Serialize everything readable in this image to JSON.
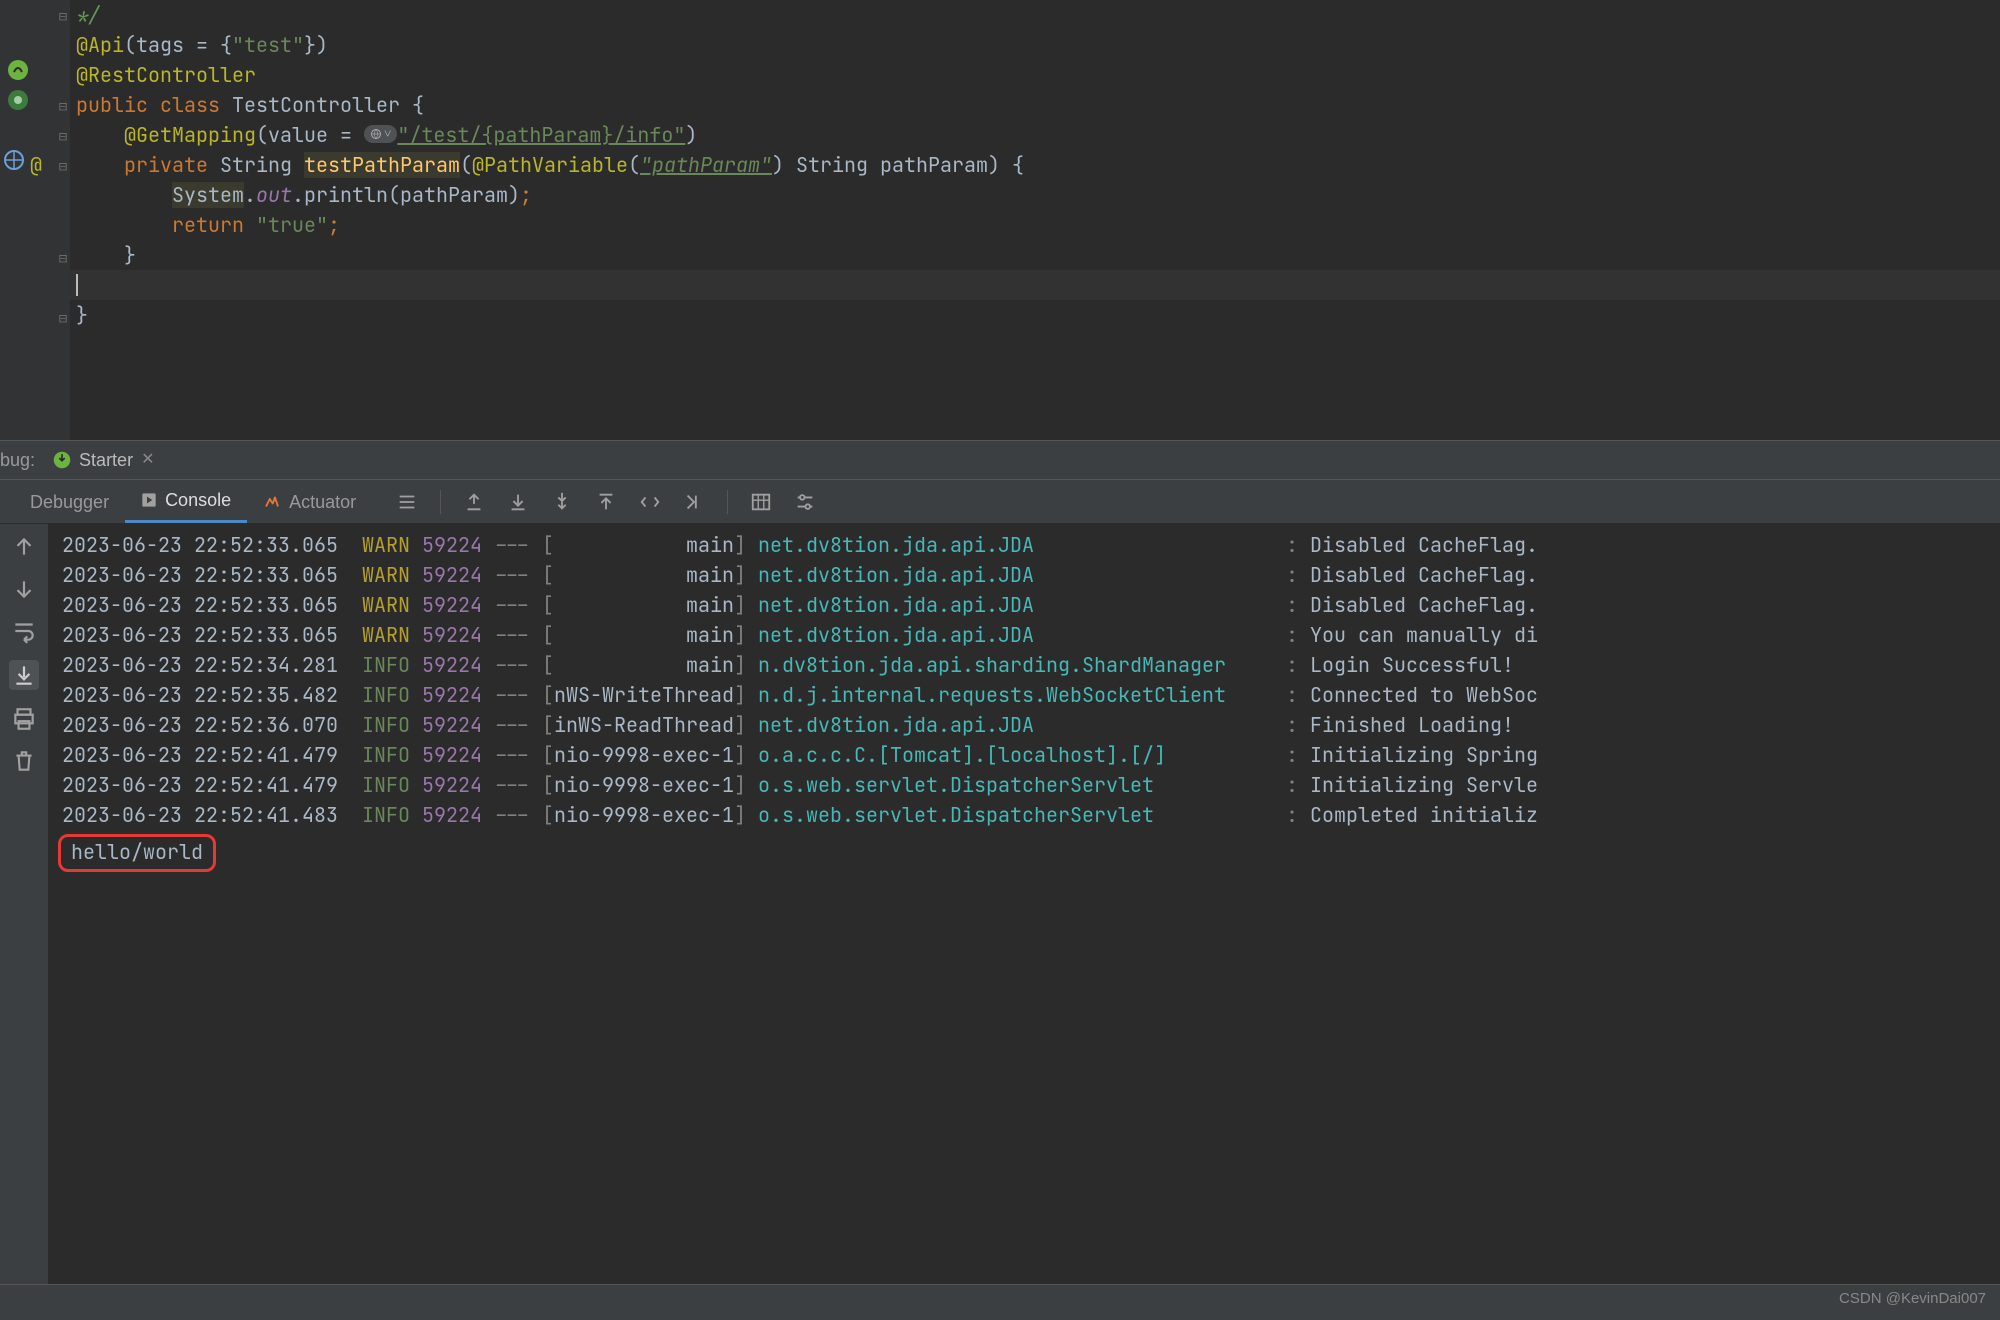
{
  "code": {
    "comment_close": "*/",
    "api_anno": "@Api",
    "api_args_open": "(tags = {",
    "api_tag": "\"test\"",
    "api_args_close": "})",
    "restctrl": "@RestController",
    "kw_public": "public",
    "kw_class": "class",
    "class_name": "TestController",
    "brace_open": "{",
    "getmap": "@GetMapping",
    "getmap_arg_open": "(value = ",
    "url": "\"/test/{pathParam}/info\"",
    "getmap_arg_close": ")",
    "kw_private": "private",
    "ret_type": "String",
    "method_name": "testPathParam",
    "pathvar": "@PathVariable",
    "pathvar_name": "\"pathParam\"",
    "param_type": "String",
    "param_name": "pathParam",
    "system": "System",
    "out": "out",
    "println": "println",
    "println_arg": "pathParam",
    "kw_return": "return",
    "ret_value": "\"true\"",
    "brace_close": "}"
  },
  "runcfg": {
    "label": "bug:",
    "tab": "Starter"
  },
  "tool_tabs": {
    "debugger": "Debugger",
    "console": "Console",
    "actuator": "Actuator"
  },
  "log_cols": {
    "ts": [
      "2023-06-23 22:52:33.065",
      "2023-06-23 22:52:33.065",
      "2023-06-23 22:52:33.065",
      "2023-06-23 22:52:33.065",
      "2023-06-23 22:52:34.281",
      "2023-06-23 22:52:35.482",
      "2023-06-23 22:52:36.070",
      "2023-06-23 22:52:41.479",
      "2023-06-23 22:52:41.479",
      "2023-06-23 22:52:41.483"
    ],
    "lvl": [
      "WARN",
      "WARN",
      "WARN",
      "WARN",
      "INFO",
      "INFO",
      "INFO",
      "INFO",
      "INFO",
      "INFO"
    ],
    "pid": "59224",
    "thr": [
      "           main",
      "           main",
      "           main",
      "           main",
      "           main",
      "nWS-WriteThread",
      "inWS-ReadThread",
      "nio-9998-exec-1",
      "nio-9998-exec-1",
      "nio-9998-exec-1"
    ],
    "cls": [
      "net.dv8tion.jda.api.JDA",
      "net.dv8tion.jda.api.JDA",
      "net.dv8tion.jda.api.JDA",
      "net.dv8tion.jda.api.JDA",
      "n.dv8tion.jda.api.sharding.ShardManager",
      "n.d.j.internal.requests.WebSocketClient",
      "net.dv8tion.jda.api.JDA",
      "o.a.c.c.C.[Tomcat].[localhost].[/]",
      "o.s.web.servlet.DispatcherServlet",
      "o.s.web.servlet.DispatcherServlet"
    ],
    "msg": [
      "Disabled CacheFlag.",
      "Disabled CacheFlag.",
      "Disabled CacheFlag.",
      "You can manually di",
      "Login Successful!",
      "Connected to WebSoc",
      "Finished Loading!",
      "Initializing Spring",
      "Initializing Servle",
      "Completed initializ"
    ]
  },
  "console_out": "hello/world",
  "watermark": "CSDN @KevinDai007"
}
